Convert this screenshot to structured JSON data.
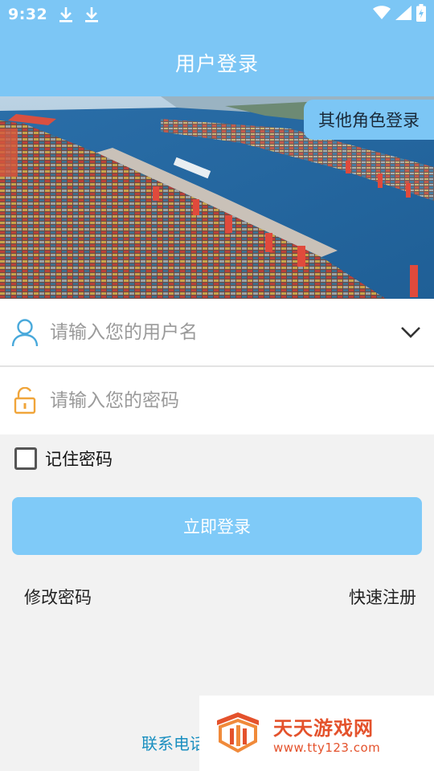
{
  "status_bar": {
    "time": "9:32",
    "left_icons": [
      "download-icon",
      "download-icon"
    ],
    "right_icons": [
      "wifi-icon",
      "signal-icon",
      "battery-icon"
    ]
  },
  "app_bar": {
    "title": "用户登录"
  },
  "banner": {
    "image": "port-aerial-photo",
    "role_button": "其他角色登录"
  },
  "form": {
    "username": {
      "placeholder": "请输入您的用户名",
      "value": "",
      "icon": "user-icon"
    },
    "password": {
      "placeholder": "请输入您的密码",
      "value": "",
      "icon": "lock-icon"
    },
    "remember": {
      "label": "记住密码",
      "checked": false
    },
    "login_button": "立即登录"
  },
  "links": {
    "change_password": "修改密码",
    "quick_register": "快速注册"
  },
  "footer": {
    "contact": "联系电话"
  },
  "watermark": {
    "title": "天天游戏网",
    "url": "www.tty123.com"
  },
  "colors": {
    "primary": "#7cc6f5",
    "button": "#7fcaf8",
    "background": "#f2f2f2",
    "accent_watermark": "#e4522c"
  }
}
